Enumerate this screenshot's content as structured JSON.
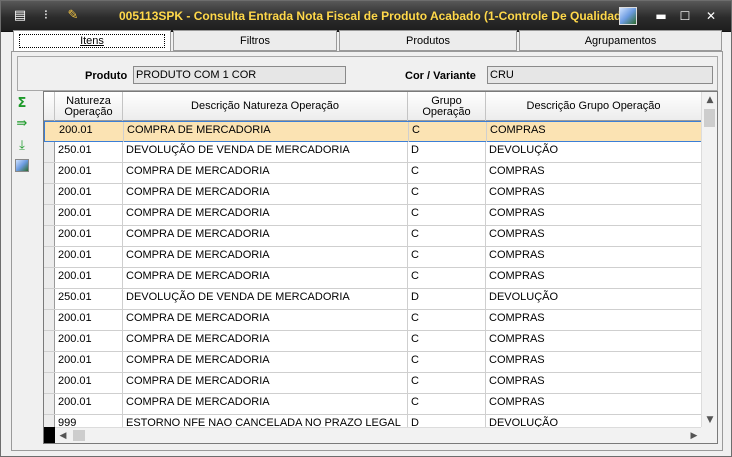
{
  "window": {
    "title": "005113SPK - Consulta Entrada Nota Fiscal de Produto Acabado (1-Controle De Qualidade",
    "minimize_glyph": "▬",
    "maximize_glyph": "☐",
    "close_glyph": "✕"
  },
  "tabs": [
    {
      "label": "Itens"
    },
    {
      "label": "Filtros"
    },
    {
      "label": "Produtos"
    },
    {
      "label": "Agrupamentos"
    }
  ],
  "fields": {
    "produto_label": "Produto",
    "produto_value": "PRODUTO COM 1 COR",
    "cor_label": "Cor / Variante",
    "cor_value": "CRU"
  },
  "grid": {
    "headers": [
      "Natureza Operação",
      "Descrição Natureza Operação",
      "Grupo Operação",
      "Descrição Grupo Operação"
    ],
    "rows": [
      [
        "200.01",
        "COMPRA DE MERCADORIA",
        "C",
        "COMPRAS"
      ],
      [
        "250.01",
        "DEVOLUÇÃO DE VENDA DE MERCADORIA",
        "D",
        "DEVOLUÇÃO"
      ],
      [
        "200.01",
        "COMPRA DE MERCADORIA",
        "C",
        "COMPRAS"
      ],
      [
        "200.01",
        "COMPRA DE MERCADORIA",
        "C",
        "COMPRAS"
      ],
      [
        "200.01",
        "COMPRA DE MERCADORIA",
        "C",
        "COMPRAS"
      ],
      [
        "200.01",
        "COMPRA DE MERCADORIA",
        "C",
        "COMPRAS"
      ],
      [
        "200.01",
        "COMPRA DE MERCADORIA",
        "C",
        "COMPRAS"
      ],
      [
        "200.01",
        "COMPRA DE MERCADORIA",
        "C",
        "COMPRAS"
      ],
      [
        "250.01",
        "DEVOLUÇÃO DE VENDA DE MERCADORIA",
        "D",
        "DEVOLUÇÃO"
      ],
      [
        "200.01",
        "COMPRA DE MERCADORIA",
        "C",
        "COMPRAS"
      ],
      [
        "200.01",
        "COMPRA DE MERCADORIA",
        "C",
        "COMPRAS"
      ],
      [
        "200.01",
        "COMPRA DE MERCADORIA",
        "C",
        "COMPRAS"
      ],
      [
        "200.01",
        "COMPRA DE MERCADORIA",
        "C",
        "COMPRAS"
      ],
      [
        "200.01",
        "COMPRA DE MERCADORIA",
        "C",
        "COMPRAS"
      ],
      [
        "999",
        "ESTORNO NFE NAO CANCELADA NO PRAZO LEGAL",
        "D",
        "DEVOLUÇÃO"
      ]
    ],
    "selected_row": 0
  },
  "icons": {
    "title_left": [
      "list-export-icon",
      "traffic-light-icon",
      "wrench-icon"
    ],
    "title_right": "image-icon",
    "side_tools": [
      "sum-icon",
      "export-icon",
      "download-icon",
      "image-icon"
    ]
  },
  "colors": {
    "title_text": "#ffd84a",
    "selected_row": "#fbe3b3",
    "selection_border": "#3c7fd6"
  }
}
